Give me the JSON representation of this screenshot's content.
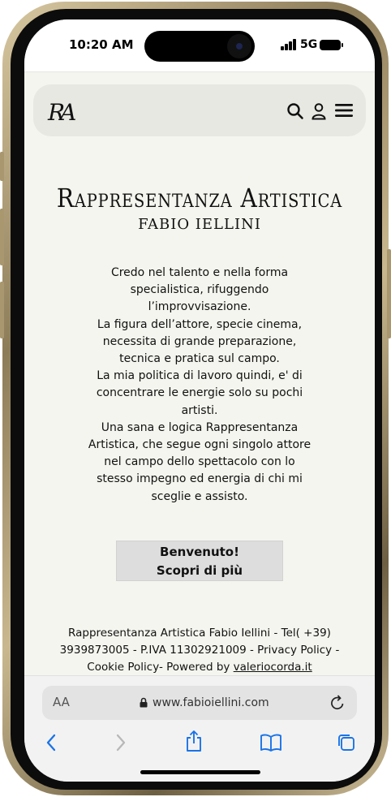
{
  "status_bar": {
    "time": "10:20 AM",
    "network": "5G"
  },
  "header": {
    "logo": "RA",
    "icons": [
      "search-icon",
      "user-icon",
      "menu-icon"
    ]
  },
  "hero": {
    "title": "Rappresentanza Artistica",
    "subtitle": "FABIO IELLINI"
  },
  "intro_lines": [
    "Credo nel talento e nella forma\nspecialistica, rifuggendo\nl’improvvisazione.",
    "La figura dell’attore, specie cinema,\nnecessita di grande preparazione,\ntecnica e pratica sul campo.",
    "La mia politica di lavoro quindi, e' di\nconcentrare le energie solo su pochi\nartisti.",
    "Una sana e logica Rappresentanza\nArtistica, che segue ogni singolo attore\nnel campo dello spettacolo con lo\nstesso impegno ed energia di chi mi\nsceglie e assisto."
  ],
  "cta": {
    "line1": "Benvenuto!",
    "line2": "Scopri di più"
  },
  "footer": {
    "text": "Rappresentanza Artistica Fabio Iellini - Tel( +39) 3939873005 - P.IVA 11302921009 - Privacy Policy - Cookie Policy- Powered by ",
    "link": "valeriocorda.it"
  },
  "browser": {
    "text_size_label": "AA",
    "url": "www.fabioiellini.com",
    "nav_icons": [
      "back-icon",
      "forward-icon",
      "share-icon",
      "bookmarks-icon",
      "tabs-icon"
    ]
  },
  "colors": {
    "page_bg": "#f5f5ef",
    "header_bg": "#e8e8e3",
    "cta_bg": "#dddddd",
    "safari_blue": "#1a73e8"
  }
}
